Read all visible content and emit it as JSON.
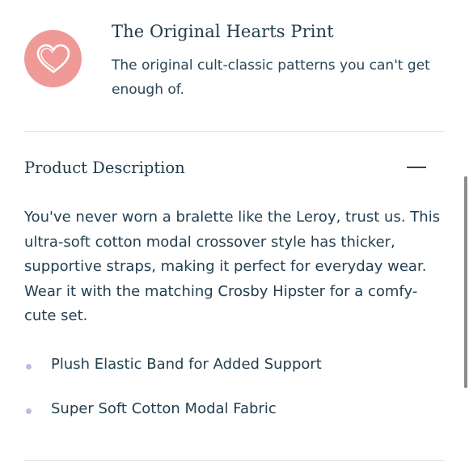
{
  "feature": {
    "icon": "heart-icon",
    "badge_color": "#ef9a97",
    "title": "The Original Hearts Print",
    "subtitle": "The original cult-classic patterns you can't get enough of."
  },
  "product_description": {
    "title": "Product Description",
    "toggle_icon": "minus-icon",
    "body": "You've never worn a bralette like the Leroy, trust us. This ultra-soft cotton modal crossover style has thicker, supportive straps, making it perfect for everyday wear. Wear it with the matching Crosby Hipster for a comfy-cute set.",
    "bullets": [
      "Plush Elastic Band for Added Support",
      "Super Soft Cotton Modal Fabric"
    ],
    "bullet_color": "#c9b6e2"
  },
  "colors": {
    "text": "#1f3a4b",
    "divider": "#e7e7e7"
  }
}
